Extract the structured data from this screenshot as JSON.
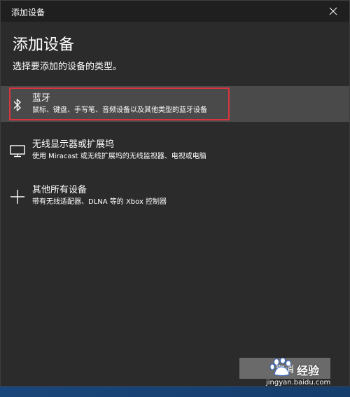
{
  "window": {
    "title": "添加设备",
    "close_icon": "close-icon"
  },
  "header": {
    "title": "添加设备",
    "subtitle": "选择要添加的设备的类型。"
  },
  "devices": [
    {
      "icon": "bluetooth-icon",
      "name": "蓝牙",
      "description": "鼠标、键盘、手写笔、音频设备以及其他类型的蓝牙设备",
      "selected": true
    },
    {
      "icon": "monitor-icon",
      "name": "无线显示器或扩展坞",
      "description": "使用 Miracast 或无线扩展坞的无线监视器、电视或电脑",
      "selected": false
    },
    {
      "icon": "plus-icon",
      "name": "其他所有设备",
      "description": "带有无线适配器、DLNA 等的 Xbox 控制器",
      "selected": false
    }
  ],
  "footer": {
    "cancel_label": "取消"
  },
  "watermark": {
    "brand": "经验",
    "url": "jingyan.baidu.com"
  },
  "colors": {
    "dialog_bg": "#2b2b2b",
    "titlebar_bg": "#1f1f1f",
    "selected_bg": "#4a4a4a",
    "highlight_border": "#d9353f",
    "button_bg": "#6a6a6a"
  }
}
